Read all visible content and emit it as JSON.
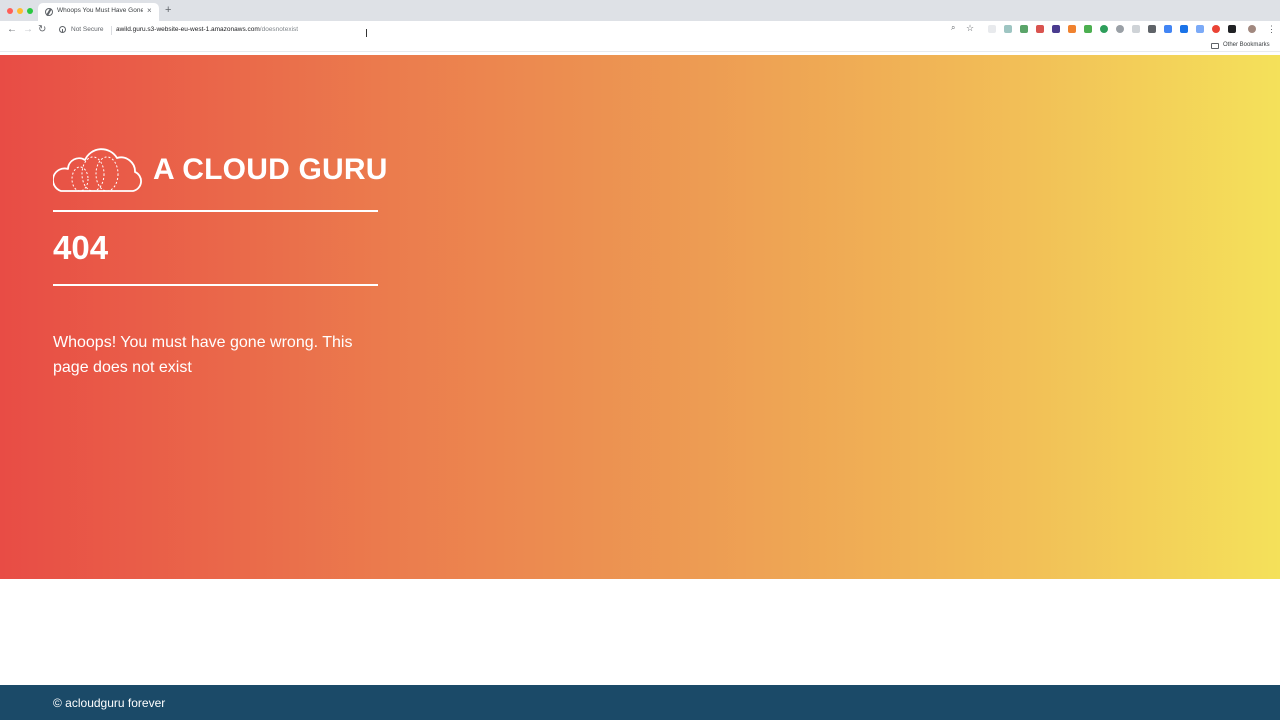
{
  "browser": {
    "tab_title": "Whoops You Must Have Gone",
    "new_tab_label": "+",
    "close_tab_label": "×",
    "security_label": "Not Secure",
    "url_host": "awild.guru.s3-website-eu-west-1.amazonaws.com",
    "url_path": "/doesnotexist",
    "bookmarks_label": "Other Bookmarks",
    "menu_label": "⋮"
  },
  "page": {
    "brand_name": "A CLOUD GURU",
    "error_code": "404",
    "message": "Whoops! You must have gone wrong. This page does not exist",
    "footer_text": "© acloudguru forever"
  },
  "colors": {
    "gradient_start": "#e84c45",
    "gradient_end": "#f4e15a",
    "footer": "#1b4a68"
  },
  "icons": [
    "back-icon",
    "forward-icon",
    "reload-icon",
    "info-icon",
    "zoom-icon",
    "star-icon",
    "folder-icon",
    "cloud-logo-icon"
  ]
}
